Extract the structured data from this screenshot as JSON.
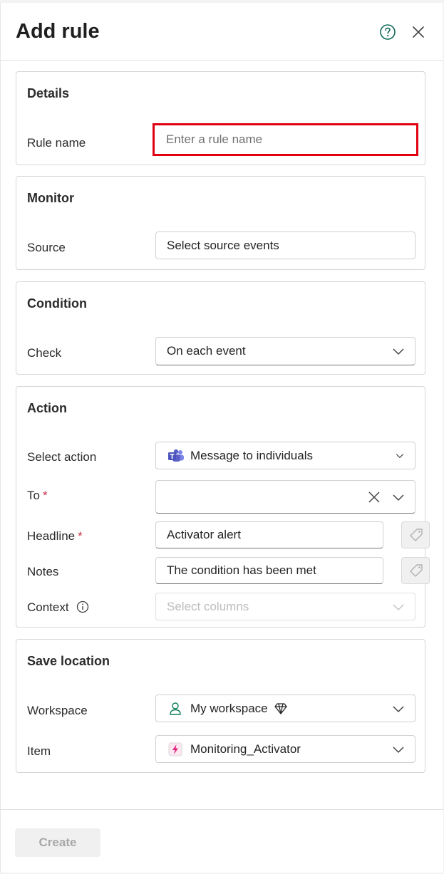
{
  "header": {
    "title": "Add rule",
    "help_icon": "help-circle-icon",
    "close_icon": "close-icon"
  },
  "details": {
    "title": "Details",
    "rule_name_label": "Rule name",
    "rule_name_value": "",
    "rule_name_placeholder": "Enter a rule name"
  },
  "monitor": {
    "title": "Monitor",
    "source_label": "Source",
    "source_value": "Select source events"
  },
  "condition": {
    "title": "Condition",
    "check_label": "Check",
    "check_value": "On each event"
  },
  "action": {
    "title": "Action",
    "select_action_label": "Select action",
    "select_action_value": "Message to individuals",
    "to_label": "To",
    "to_value": "",
    "headline_label": "Headline",
    "headline_value": "Activator alert",
    "notes_label": "Notes",
    "notes_value": "The condition has been met",
    "context_label": "Context",
    "context_placeholder": "Select columns",
    "required_marker": "*"
  },
  "save_location": {
    "title": "Save location",
    "workspace_label": "Workspace",
    "workspace_value": "My workspace",
    "item_label": "Item",
    "item_value": "Monitoring_Activator"
  },
  "footer": {
    "create_label": "Create"
  },
  "colors": {
    "highlight": "#e00010",
    "teams": "#5b5fc7",
    "activator": "#e3257f",
    "workspace_icon": "#0f7b55",
    "required": "#c4314b"
  }
}
